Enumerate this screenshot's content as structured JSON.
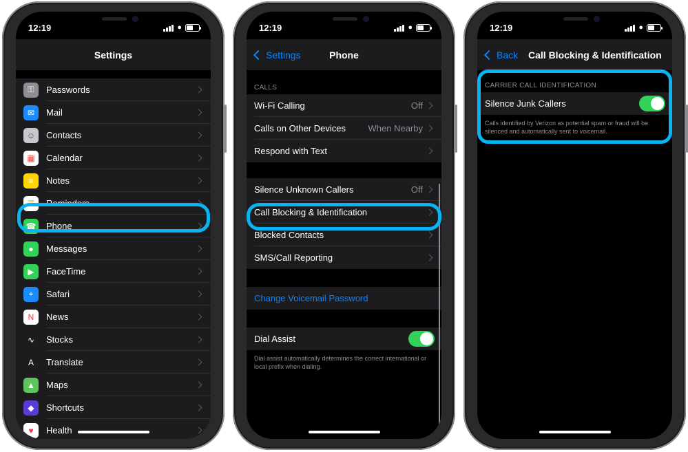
{
  "phones": [
    {
      "time": "12:19",
      "title": "Settings",
      "items": [
        {
          "label": "Passwords",
          "icon": "key-icon",
          "color": "#8e8e93"
        },
        {
          "label": "Mail",
          "icon": "mail-icon",
          "color": "#1a8cff"
        },
        {
          "label": "Contacts",
          "icon": "contacts-icon",
          "color": "#c7c7cc"
        },
        {
          "label": "Calendar",
          "icon": "calendar-icon",
          "color": "#ffffff"
        },
        {
          "label": "Notes",
          "icon": "notes-icon",
          "color": "#ffd60a"
        },
        {
          "label": "Reminders",
          "icon": "reminders-icon",
          "color": "#ffffff"
        },
        {
          "label": "Phone",
          "icon": "phone-icon",
          "color": "#32d158"
        },
        {
          "label": "Messages",
          "icon": "messages-icon",
          "color": "#32d158"
        },
        {
          "label": "FaceTime",
          "icon": "facetime-icon",
          "color": "#32d158"
        },
        {
          "label": "Safari",
          "icon": "safari-icon",
          "color": "#1a8cff"
        },
        {
          "label": "News",
          "icon": "news-icon",
          "color": "#ffffff"
        },
        {
          "label": "Stocks",
          "icon": "stocks-icon",
          "color": "#1c1c1e"
        },
        {
          "label": "Translate",
          "icon": "translate-icon",
          "color": "#1c1c1e"
        },
        {
          "label": "Maps",
          "icon": "maps-icon",
          "color": "#5fc45b"
        },
        {
          "label": "Shortcuts",
          "icon": "shortcuts-icon",
          "color": "#5b3bd6"
        },
        {
          "label": "Health",
          "icon": "health-icon",
          "color": "#ffffff"
        }
      ]
    },
    {
      "time": "12:19",
      "back_label": "Settings",
      "title": "Phone",
      "calls_header": "CALLS",
      "calls": [
        {
          "label": "Wi-Fi Calling",
          "value": "Off"
        },
        {
          "label": "Calls on Other Devices",
          "value": "When Nearby"
        },
        {
          "label": "Respond with Text",
          "value": ""
        }
      ],
      "blocking": [
        {
          "label": "Silence Unknown Callers",
          "value": "Off"
        },
        {
          "label": "Call Blocking & Identification",
          "value": ""
        },
        {
          "label": "Blocked Contacts",
          "value": ""
        },
        {
          "label": "SMS/Call Reporting",
          "value": ""
        }
      ],
      "voicemail_link": "Change Voicemail Password",
      "dial_assist": {
        "label": "Dial Assist",
        "on": true,
        "note": "Dial assist automatically determines the correct international or local prefix when dialing."
      }
    },
    {
      "time": "12:19",
      "back_label": "Back",
      "title": "Call Blocking & Identification",
      "section_header": "CARRIER CALL IDENTIFICATION",
      "toggle_label": "Silence Junk Callers",
      "toggle_on": true,
      "note": "Calls identified by Verizon as potential spam or fraud will be silenced and automatically sent to voicemail."
    }
  ],
  "highlight_color": "#0ab4f0"
}
